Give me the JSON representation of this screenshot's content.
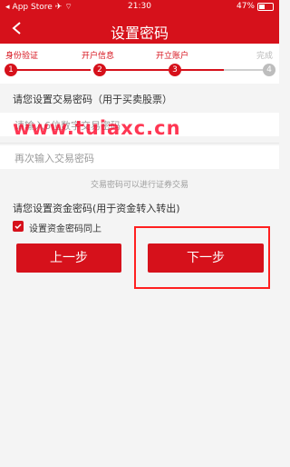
{
  "status_bar": {
    "carrier": "App Store",
    "time": "21:30",
    "battery": "47%",
    "battery_level": 0.47
  },
  "header": {
    "title": "设置密码",
    "back_icon": "chevron-left-icon"
  },
  "steps": [
    {
      "label": "身份验证",
      "number": "1",
      "active": true
    },
    {
      "label": "开户信息",
      "number": "2",
      "active": true
    },
    {
      "label": "开立账户",
      "number": "3",
      "active": true
    },
    {
      "label": "完成",
      "number": "4",
      "active": false
    }
  ],
  "trade_password": {
    "title": "请您设置交易密码（用于买卖股票）",
    "input1_placeholder": "请输入6位数字交易密码",
    "input2_placeholder": "再次输入交易密码",
    "hint": "交易密码可以进行证券交易"
  },
  "fund_password": {
    "title": "请您设置资金密码(用于资金转入转出)",
    "checkbox_label": "设置资金密码同上",
    "checked": true
  },
  "buttons": {
    "prev": "上一步",
    "next": "下一步"
  },
  "watermark": "www.tuiaxc.cn",
  "colors": {
    "brand_red": "#d6111b",
    "watermark_red": "#ff0024",
    "highlight_red": "#ff1f1f"
  }
}
